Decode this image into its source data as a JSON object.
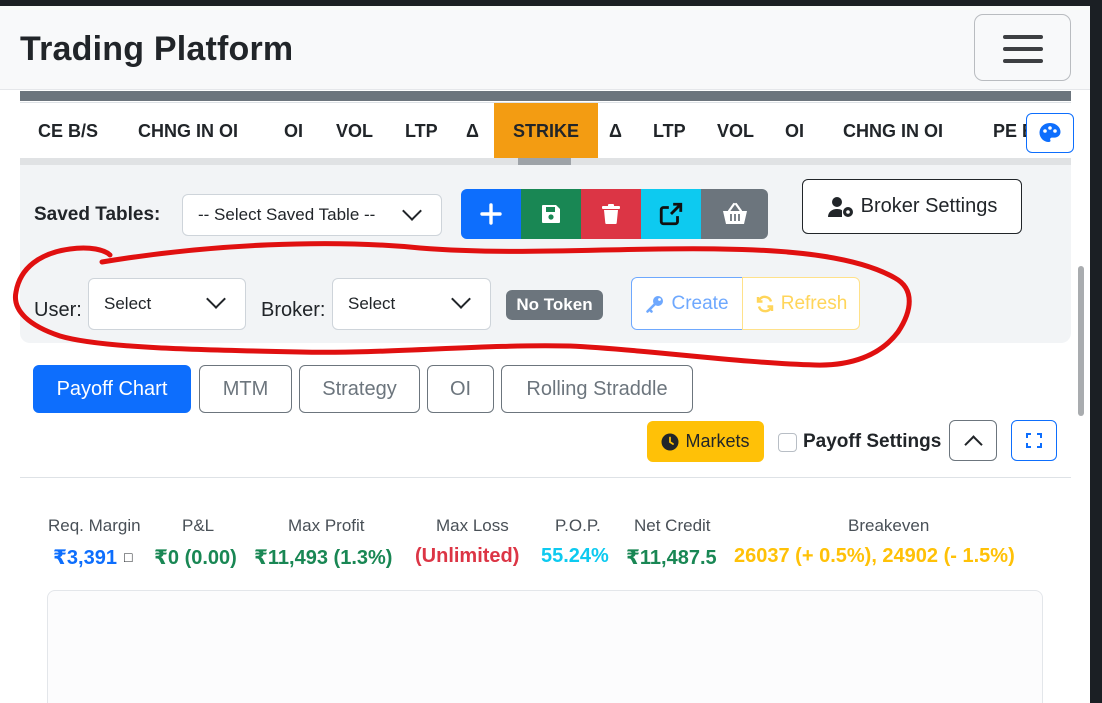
{
  "navbar": {
    "brand": "Trading Platform",
    "menu_icon": "hamburger-icon"
  },
  "option_chain_header": {
    "columns": [
      "CE B/S",
      "CHNG IN OI",
      "OI",
      "VOL",
      "LTP",
      "Δ",
      "STRIKE",
      "Δ",
      "LTP",
      "VOL",
      "OI",
      "CHNG IN OI",
      "PE B/S"
    ],
    "palette_icon": "palette-icon"
  },
  "saved_tables": {
    "label": "Saved Tables:",
    "select_value": "-- Select Saved Table --",
    "actions": [
      {
        "icon": "plus-icon",
        "color": "#0d6efd"
      },
      {
        "icon": "save-icon",
        "color": "#198754"
      },
      {
        "icon": "trash-icon",
        "color": "#dc3545"
      },
      {
        "icon": "external-link-icon",
        "color": "#0dcaf0"
      },
      {
        "icon": "basket-icon",
        "color": "#6c757d"
      }
    ]
  },
  "broker_settings": {
    "label": "Broker Settings",
    "icon": "user-gear-icon"
  },
  "account": {
    "user_label": "User:",
    "user_value": "Select",
    "broker_label": "Broker:",
    "broker_value": "Select",
    "token_badge": "No Token",
    "create_label": "Create",
    "create_icon": "key-icon",
    "refresh_label": "Refresh",
    "refresh_icon": "refresh-icon"
  },
  "tabs": [
    {
      "label": "Payoff Chart",
      "active": true
    },
    {
      "label": "MTM",
      "active": false
    },
    {
      "label": "Strategy",
      "active": false
    },
    {
      "label": "OI",
      "active": false
    },
    {
      "label": "Rolling Straddle",
      "active": false
    }
  ],
  "toolbar": {
    "markets_label": "Markets",
    "markets_icon": "clock-icon",
    "payoff_settings_label": "Payoff Settings",
    "payoff_settings_checked": false,
    "collapse_icon": "chevron-up-icon",
    "expand_icon": "fullscreen-icon"
  },
  "stats": {
    "req_margin": {
      "label": "Req. Margin",
      "value": "₹3,391",
      "extra": "□",
      "color": "#0d6efd"
    },
    "pnl": {
      "label": "P&L",
      "value": "₹0 (0.00)",
      "color": "#198754"
    },
    "max_profit": {
      "label": "Max Profit",
      "value": "₹11,493 (1.3%)",
      "color": "#198754"
    },
    "max_loss": {
      "label": "Max Loss",
      "value": "(Unlimited)",
      "color": "#dc3545"
    },
    "pop": {
      "label": "P.O.P.",
      "value": "55.24%",
      "color": "#0dcaf0"
    },
    "net_credit": {
      "label": "Net Credit",
      "value": "₹11,487.5",
      "color": "#198754"
    },
    "breakeven": {
      "label": "Breakeven",
      "value": "26037 (+ 0.5%), 24902 (- 1.5%)",
      "color": "#ffc107"
    }
  },
  "colors": {
    "primary": "#0d6efd",
    "strike_highlight": "#f39c12",
    "annotation_circle": "#e01010"
  }
}
